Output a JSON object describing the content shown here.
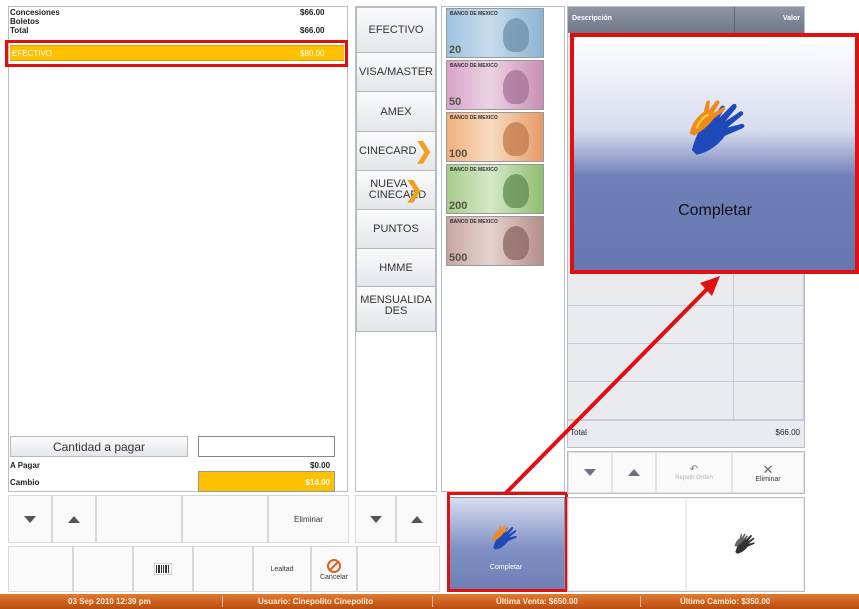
{
  "summary": {
    "rows": [
      {
        "label": "Concesiones",
        "value": "$66.00"
      },
      {
        "label": "Boletos",
        "value": ""
      },
      {
        "label": "Total",
        "value": "$66.00"
      }
    ],
    "selected": {
      "label": "EFECTIVO",
      "value": "$80.00"
    }
  },
  "amount": {
    "button_label": "Cantidad a pagar",
    "input_value": ""
  },
  "totals": {
    "pay_label": "A Pagar",
    "pay_value": "$0.00",
    "change_label": "Cambio",
    "change_value": "$14.00"
  },
  "left_toolbar": {
    "delete_label": "Eliminar"
  },
  "left_bottom": {
    "loyalty_label": "Lealtad",
    "cancel_label": "Cancelar"
  },
  "payment_methods": [
    "EFECTIVO",
    "VISA/MASTER",
    "AMEX",
    "CINECARD",
    "NUEVA CINECARD",
    "PUNTOS",
    "HMME",
    "MENSUALIDADES"
  ],
  "bills": [
    {
      "header": "BANCO DE MEXICO",
      "denomination": "20"
    },
    {
      "header": "BANCO DE MEXICO",
      "denomination": "50"
    },
    {
      "header": "BANCO DE MEXICO",
      "denomination": "100"
    },
    {
      "header": "BANCO DE MEXICO",
      "denomination": "200"
    },
    {
      "header": "BANCO DE MEXICO",
      "denomination": "500"
    }
  ],
  "order_table": {
    "col_desc": "Descripción",
    "col_value": "Valor",
    "total_label": "Total",
    "total_value": "$66.00"
  },
  "right_toolbar": {
    "repeat_label": "Repetir Orden",
    "delete_label": "Eliminar"
  },
  "complete": {
    "small_label": "Completar",
    "zoom_label": "Completar"
  },
  "status_bar": {
    "datetime": "03 Sep 2010 12:39 pm",
    "user": "Usuario:  Cinepolito  Cinepolito",
    "last_sale": "Última Venta: $650.00",
    "last_change": "Último Cambio:  $350.00"
  },
  "colors": {
    "highlight": "#ffc000",
    "accent_red": "#e01010",
    "status_bar": "#c85a18",
    "complete_bg": "#6d7fb5"
  }
}
